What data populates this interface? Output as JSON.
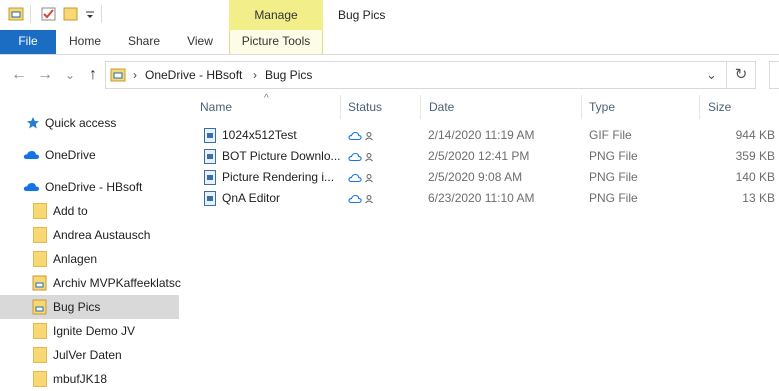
{
  "titlebar": {
    "manage_label": "Manage",
    "window_title": "Bug Pics"
  },
  "ribbon": {
    "tabs": [
      "File",
      "Home",
      "Share",
      "View",
      "Picture Tools"
    ]
  },
  "address": {
    "crumbs": [
      "OneDrive - HBsoft",
      "Bug Pics"
    ],
    "separator": "›"
  },
  "nav_buttons": {
    "back": "←",
    "forward": "→",
    "recent": "⌄",
    "up": "↑",
    "dropdown": "⌄",
    "refresh": "↻"
  },
  "navpane": {
    "quick_access": "Quick access",
    "onedrive": "OneDrive",
    "onedrive_hbsoft": "OneDrive - HBsoft",
    "folders": [
      "Add to",
      "Andrea Austausch",
      "Anlagen",
      "Archiv MVPKaffeeklatsc",
      "Bug Pics",
      "Ignite Demo JV",
      "JulVer Daten",
      "mbufJK18"
    ],
    "selected": "Bug Pics"
  },
  "filelist": {
    "columns": {
      "name": "Name",
      "status": "Status",
      "date": "Date",
      "type": "Type",
      "size": "Size",
      "sort_indicator": "^"
    },
    "rows": [
      {
        "name": "1024x512Test",
        "date": "2/14/2020 11:19 AM",
        "type": "GIF File",
        "size": "944 KB"
      },
      {
        "name": "BOT Picture Downlo...",
        "date": "2/5/2020 12:41 PM",
        "type": "PNG File",
        "size": "359 KB"
      },
      {
        "name": "Picture Rendering i...",
        "date": "2/5/2020 9:08 AM",
        "type": "PNG File",
        "size": "140 KB"
      },
      {
        "name": "QnA Editor",
        "date": "6/23/2020 11:10 AM",
        "type": "PNG File",
        "size": "13 KB"
      }
    ]
  },
  "colors": {
    "file_tab": "#1a6dc2",
    "manage_tab": "#f2ef8b",
    "onedrive_blue": "#1473e6",
    "selected_row": "#d9d9d9",
    "column_header_text": "#4c607a"
  }
}
